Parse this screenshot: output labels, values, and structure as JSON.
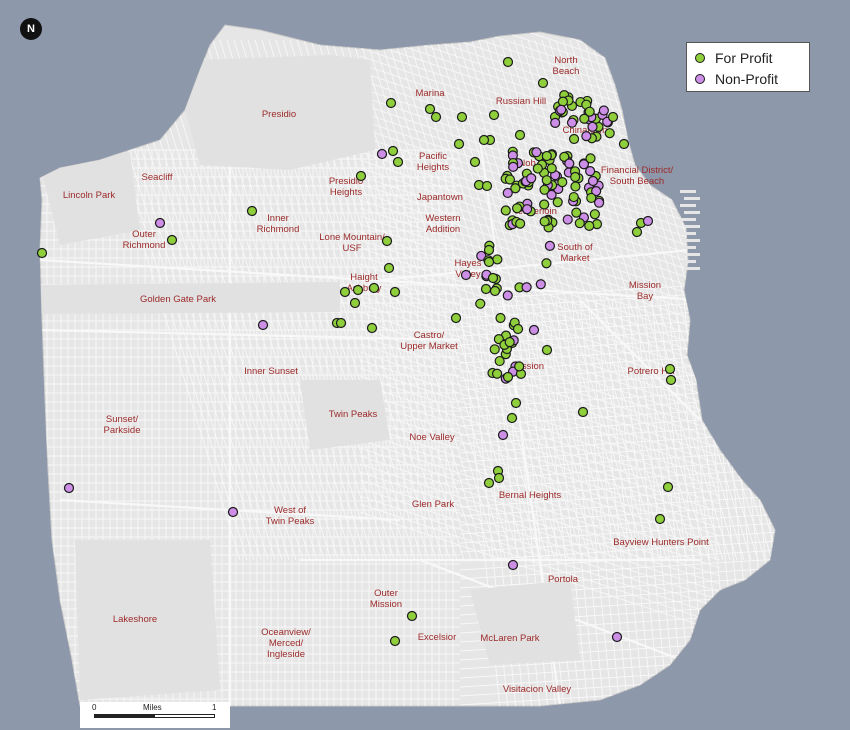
{
  "map": {
    "north_label": "N",
    "colors": {
      "water": "#8d98aa",
      "land": "#e6e6e6",
      "street": "#f8f8f8",
      "label": "#9c2a2a",
      "for_profit": "#8fcf3c",
      "non_profit": "#cc8ee6"
    }
  },
  "legend": {
    "items": [
      {
        "label": "For Profit",
        "color": "#8fcf3c"
      },
      {
        "label": "Non-Profit",
        "color": "#cc8ee6"
      }
    ]
  },
  "scale_bar": {
    "start": "0",
    "unit": "Miles",
    "end": "1"
  },
  "neighborhoods": [
    [
      "North",
      "Beach"
    ],
    [
      "Marina"
    ],
    [
      "Russian Hill"
    ],
    [
      "Presidio"
    ],
    [
      "Chinatown"
    ],
    [
      "Pacific",
      "Heights"
    ],
    [
      "Nob Hill"
    ],
    [
      "Financial District/",
      "South Beach"
    ],
    [
      "Seacliff"
    ],
    [
      "Presidio",
      "Heights"
    ],
    [
      "Japantown"
    ],
    [
      "Lincoln Park"
    ],
    [
      "Inner",
      "Richmond"
    ],
    [
      "Western",
      "Addition"
    ],
    [
      "Tenderloin"
    ],
    [
      "Outer",
      "Richmond"
    ],
    [
      "Lone Mountain/",
      "USF"
    ],
    [
      "South of",
      "Market"
    ],
    [
      "Hayes",
      "Valley"
    ],
    [
      "Mission",
      "Bay"
    ],
    [
      "Golden Gate Park"
    ],
    [
      "Haight",
      "Ashbury"
    ],
    [
      "Castro/",
      "Upper Market"
    ],
    [
      "Mission"
    ],
    [
      "Potrero Hill"
    ],
    [
      "Inner Sunset"
    ],
    [
      "Twin Peaks"
    ],
    [
      "Sunset/",
      "Parkside"
    ],
    [
      "Noe Valley"
    ],
    [
      "Bernal Heights"
    ],
    [
      "Glen Park"
    ],
    [
      "West of",
      "Twin Peaks"
    ],
    [
      "Bayview Hunters Point"
    ],
    [
      "Portola"
    ],
    [
      "Outer",
      "Mission"
    ],
    [
      "Lakeshore"
    ],
    [
      "Excelsior"
    ],
    [
      "McLaren Park"
    ],
    [
      "Oceanview/",
      "Merced/",
      "Ingleside"
    ],
    [
      "Visitacion Valley"
    ]
  ]
}
